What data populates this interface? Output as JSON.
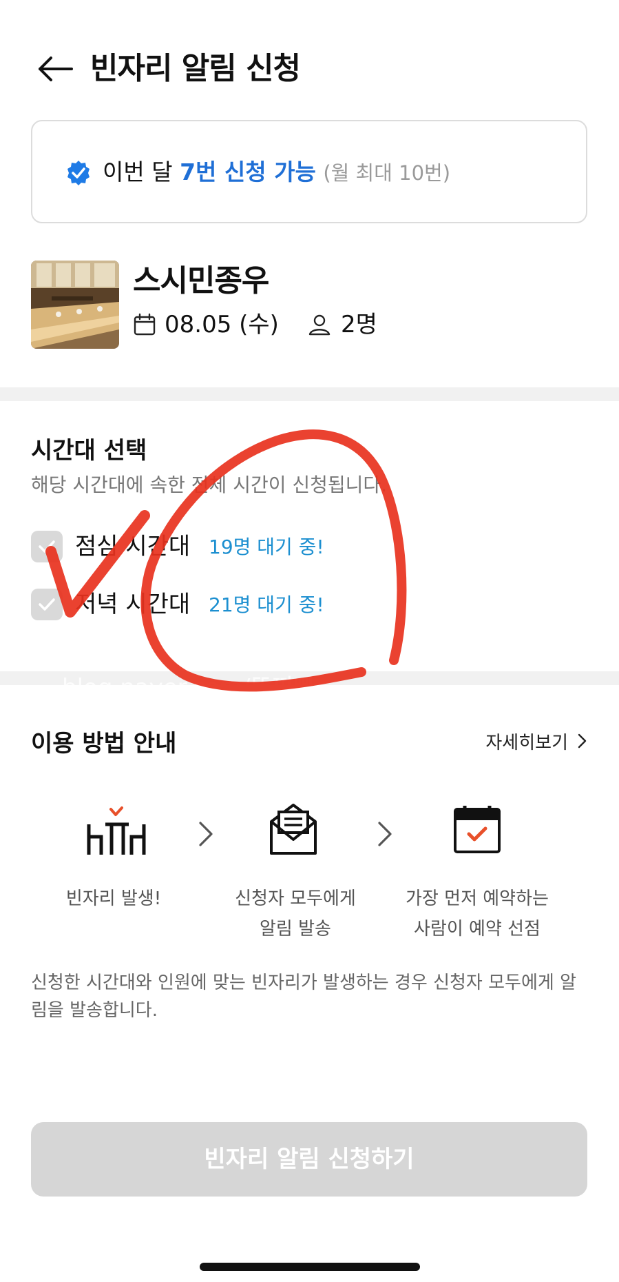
{
  "header": {
    "title": "빈자리 알림 신청"
  },
  "quota": {
    "prefix": "이번 달",
    "highlight": "7번 신청 가능",
    "note": "(월 최대 10번)"
  },
  "restaurant": {
    "name": "스시민종우",
    "date": "08.05 (수)",
    "party": "2명"
  },
  "time_selection": {
    "title": "시간대 선택",
    "subtitle": "해당 시간대에 속한 전체 시간이 신청됩니다.",
    "slots": [
      {
        "label": "점심 시간대",
        "waiting": "19명 대기 중!"
      },
      {
        "label": "저녁 시간대",
        "waiting": "21명 대기 중!"
      }
    ]
  },
  "watermark": "blog.naver.com/뚜찌빠",
  "guide": {
    "title": "이용 방법 안내",
    "details_label": "자세히보기",
    "steps": [
      {
        "line1": "빈자리 발생!",
        "line2": "",
        "icon": "vacant-seat-icon"
      },
      {
        "line1": "신청자 모두에게",
        "line2": "알림 발송",
        "icon": "envelope-icon"
      },
      {
        "line1": "가장 먼저 예약하는",
        "line2": "사람이 예약 선점",
        "icon": "calendar-check-icon"
      }
    ],
    "description": "신청한 시간대와 인원에 맞는 빈자리가 발생하는 경우 신청자 모두에게 알림을 발송합니다."
  },
  "cta": {
    "label": "빈자리 알림 신청하기"
  },
  "colors": {
    "accent_blue": "#1f6fd6",
    "waiting_blue": "#1c8fd0",
    "icon_orange": "#e8502a",
    "annotation_red": "#e8321e",
    "disabled_button": "#d6d6d6"
  }
}
